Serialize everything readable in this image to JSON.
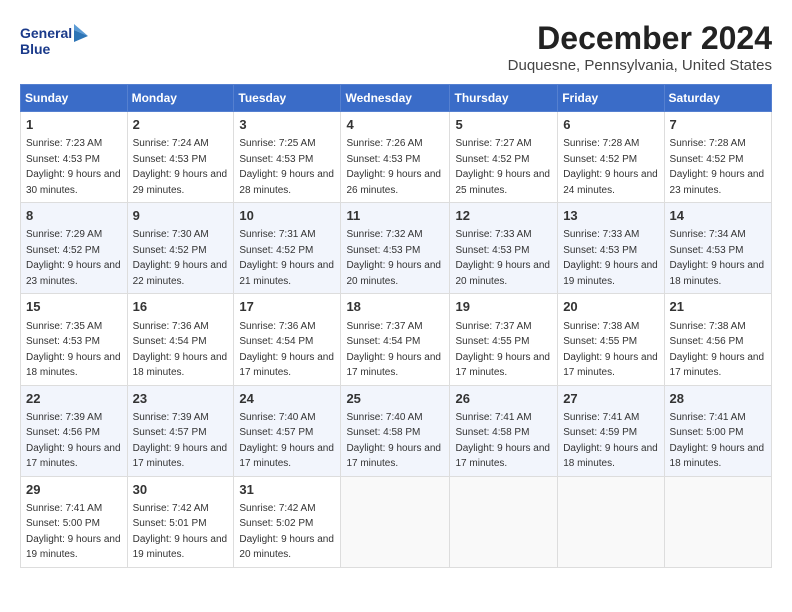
{
  "header": {
    "logo_line1": "General",
    "logo_line2": "Blue",
    "month": "December 2024",
    "location": "Duquesne, Pennsylvania, United States"
  },
  "weekdays": [
    "Sunday",
    "Monday",
    "Tuesday",
    "Wednesday",
    "Thursday",
    "Friday",
    "Saturday"
  ],
  "weeks": [
    [
      {
        "day": "1",
        "sunrise": "7:23 AM",
        "sunset": "4:53 PM",
        "daylight": "9 hours and 30 minutes."
      },
      {
        "day": "2",
        "sunrise": "7:24 AM",
        "sunset": "4:53 PM",
        "daylight": "9 hours and 29 minutes."
      },
      {
        "day": "3",
        "sunrise": "7:25 AM",
        "sunset": "4:53 PM",
        "daylight": "9 hours and 28 minutes."
      },
      {
        "day": "4",
        "sunrise": "7:26 AM",
        "sunset": "4:53 PM",
        "daylight": "9 hours and 26 minutes."
      },
      {
        "day": "5",
        "sunrise": "7:27 AM",
        "sunset": "4:52 PM",
        "daylight": "9 hours and 25 minutes."
      },
      {
        "day": "6",
        "sunrise": "7:28 AM",
        "sunset": "4:52 PM",
        "daylight": "9 hours and 24 minutes."
      },
      {
        "day": "7",
        "sunrise": "7:28 AM",
        "sunset": "4:52 PM",
        "daylight": "9 hours and 23 minutes."
      }
    ],
    [
      {
        "day": "8",
        "sunrise": "7:29 AM",
        "sunset": "4:52 PM",
        "daylight": "9 hours and 23 minutes."
      },
      {
        "day": "9",
        "sunrise": "7:30 AM",
        "sunset": "4:52 PM",
        "daylight": "9 hours and 22 minutes."
      },
      {
        "day": "10",
        "sunrise": "7:31 AM",
        "sunset": "4:52 PM",
        "daylight": "9 hours and 21 minutes."
      },
      {
        "day": "11",
        "sunrise": "7:32 AM",
        "sunset": "4:53 PM",
        "daylight": "9 hours and 20 minutes."
      },
      {
        "day": "12",
        "sunrise": "7:33 AM",
        "sunset": "4:53 PM",
        "daylight": "9 hours and 20 minutes."
      },
      {
        "day": "13",
        "sunrise": "7:33 AM",
        "sunset": "4:53 PM",
        "daylight": "9 hours and 19 minutes."
      },
      {
        "day": "14",
        "sunrise": "7:34 AM",
        "sunset": "4:53 PM",
        "daylight": "9 hours and 18 minutes."
      }
    ],
    [
      {
        "day": "15",
        "sunrise": "7:35 AM",
        "sunset": "4:53 PM",
        "daylight": "9 hours and 18 minutes."
      },
      {
        "day": "16",
        "sunrise": "7:36 AM",
        "sunset": "4:54 PM",
        "daylight": "9 hours and 18 minutes."
      },
      {
        "day": "17",
        "sunrise": "7:36 AM",
        "sunset": "4:54 PM",
        "daylight": "9 hours and 17 minutes."
      },
      {
        "day": "18",
        "sunrise": "7:37 AM",
        "sunset": "4:54 PM",
        "daylight": "9 hours and 17 minutes."
      },
      {
        "day": "19",
        "sunrise": "7:37 AM",
        "sunset": "4:55 PM",
        "daylight": "9 hours and 17 minutes."
      },
      {
        "day": "20",
        "sunrise": "7:38 AM",
        "sunset": "4:55 PM",
        "daylight": "9 hours and 17 minutes."
      },
      {
        "day": "21",
        "sunrise": "7:38 AM",
        "sunset": "4:56 PM",
        "daylight": "9 hours and 17 minutes."
      }
    ],
    [
      {
        "day": "22",
        "sunrise": "7:39 AM",
        "sunset": "4:56 PM",
        "daylight": "9 hours and 17 minutes."
      },
      {
        "day": "23",
        "sunrise": "7:39 AM",
        "sunset": "4:57 PM",
        "daylight": "9 hours and 17 minutes."
      },
      {
        "day": "24",
        "sunrise": "7:40 AM",
        "sunset": "4:57 PM",
        "daylight": "9 hours and 17 minutes."
      },
      {
        "day": "25",
        "sunrise": "7:40 AM",
        "sunset": "4:58 PM",
        "daylight": "9 hours and 17 minutes."
      },
      {
        "day": "26",
        "sunrise": "7:41 AM",
        "sunset": "4:58 PM",
        "daylight": "9 hours and 17 minutes."
      },
      {
        "day": "27",
        "sunrise": "7:41 AM",
        "sunset": "4:59 PM",
        "daylight": "9 hours and 18 minutes."
      },
      {
        "day": "28",
        "sunrise": "7:41 AM",
        "sunset": "5:00 PM",
        "daylight": "9 hours and 18 minutes."
      }
    ],
    [
      {
        "day": "29",
        "sunrise": "7:41 AM",
        "sunset": "5:00 PM",
        "daylight": "9 hours and 19 minutes."
      },
      {
        "day": "30",
        "sunrise": "7:42 AM",
        "sunset": "5:01 PM",
        "daylight": "9 hours and 19 minutes."
      },
      {
        "day": "31",
        "sunrise": "7:42 AM",
        "sunset": "5:02 PM",
        "daylight": "9 hours and 20 minutes."
      },
      null,
      null,
      null,
      null
    ]
  ],
  "labels": {
    "sunrise": "Sunrise:",
    "sunset": "Sunset:",
    "daylight": "Daylight:"
  }
}
